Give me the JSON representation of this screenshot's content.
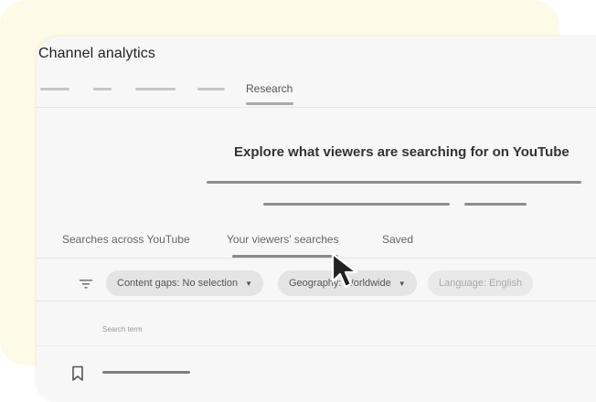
{
  "window": {
    "title": "Channel analytics"
  },
  "top_tabs": {
    "active": "Research"
  },
  "headline": "Explore what viewers are searching for on YouTube",
  "sub_tabs": [
    {
      "label": "Searches across YouTube",
      "active": false
    },
    {
      "label": "Your viewers' searches",
      "active": true
    },
    {
      "label": "Saved",
      "active": false
    }
  ],
  "filters": [
    {
      "label": "Content gaps: No selection",
      "dropdown": true,
      "enabled": true
    },
    {
      "label": "Geography: Worldwide",
      "dropdown": true,
      "enabled": true
    },
    {
      "label": "Language: English",
      "dropdown": false,
      "enabled": false
    }
  ],
  "table": {
    "column_header": "Search term"
  },
  "icons": {
    "filter": "filter-icon",
    "bookmark": "bookmark-icon",
    "cursor": "mouse-pointer-icon",
    "dropdown": "caret-down-icon"
  },
  "colors": {
    "background_card": "#fdfbe8",
    "window": "#f7f7f7"
  }
}
